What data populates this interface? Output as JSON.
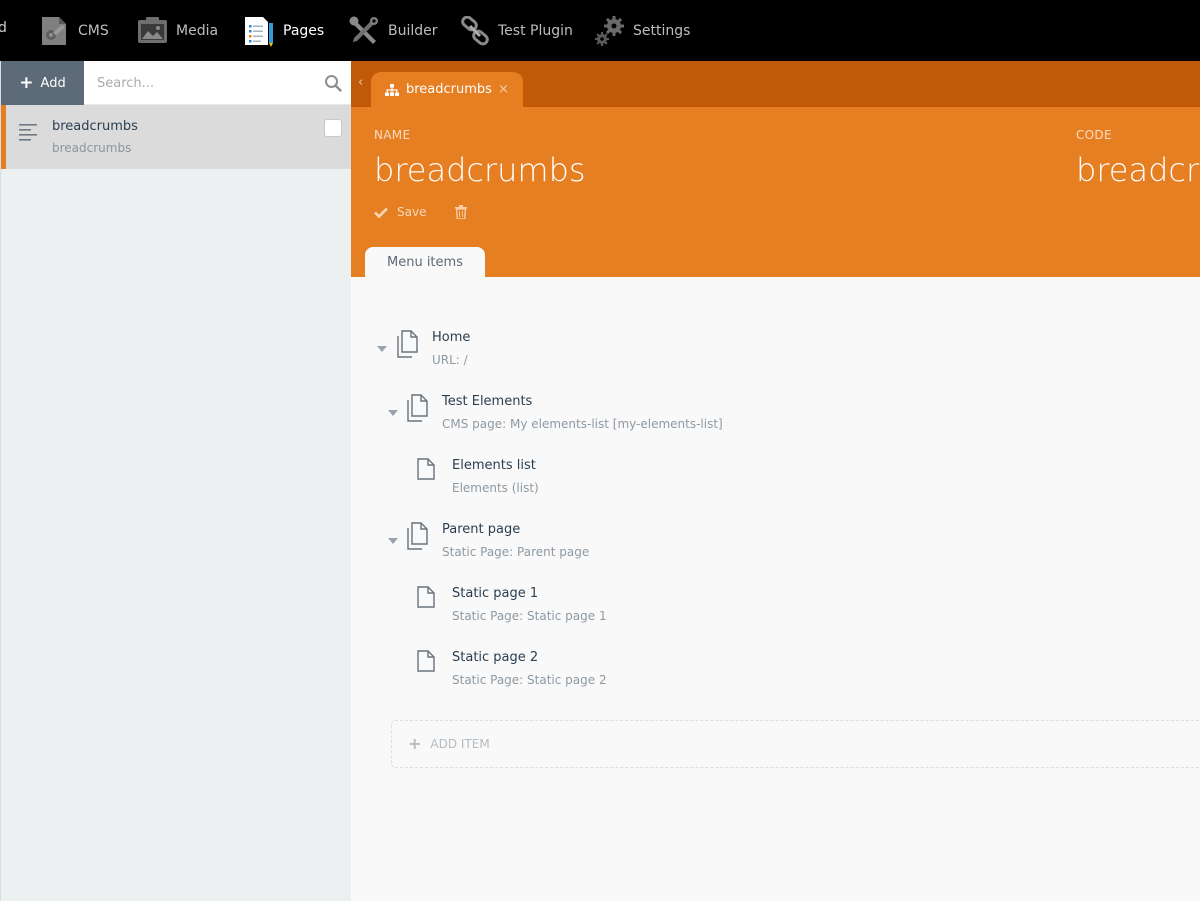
{
  "topnav": {
    "cut_label": "d",
    "items": [
      {
        "label": "CMS",
        "icon": "cms-icon"
      },
      {
        "label": "Media",
        "icon": "media-icon"
      },
      {
        "label": "Pages",
        "icon": "pages-icon",
        "active": true
      },
      {
        "label": "Builder",
        "icon": "builder-icon"
      },
      {
        "label": "Test Plugin",
        "icon": "link-icon"
      },
      {
        "label": "Settings",
        "icon": "gears-icon"
      }
    ]
  },
  "sidebar": {
    "add_label": "Add",
    "search_placeholder": "Search...",
    "items": [
      {
        "title": "breadcrumbs",
        "subtitle": "breadcrumbs"
      }
    ]
  },
  "main": {
    "tab": {
      "label": "breadcrumbs",
      "close": "×"
    },
    "tab_arrow": "‹",
    "name_label": "NAME",
    "name_value": "breadcrumbs",
    "code_label": "CODE",
    "code_value": "breadcrumbs",
    "save_label": "Save",
    "section_tab": "Menu items",
    "tree": [
      {
        "title": "Home",
        "subtitle": "URL: /",
        "level": 0,
        "expandable": true
      },
      {
        "title": "Test Elements",
        "subtitle": "CMS page: My elements-list [my-elements-list]",
        "level": 1,
        "expandable": true
      },
      {
        "title": "Elements list",
        "subtitle": "Elements (list)",
        "level": 2,
        "expandable": false
      },
      {
        "title": "Parent page",
        "subtitle": "Static Page: Parent page",
        "level": 1,
        "expandable": true
      },
      {
        "title": "Static page 1",
        "subtitle": "Static Page: Static page 1",
        "level": 2,
        "expandable": false
      },
      {
        "title": "Static page 2",
        "subtitle": "Static Page: Static page 2",
        "level": 2,
        "expandable": false
      }
    ],
    "add_item_label": "ADD ITEM"
  },
  "colors": {
    "accent": "#e67e22",
    "tabbar": "#c05a08",
    "topnav": "#000000",
    "sidebar": "#ecf0f1",
    "add_button": "#5d6a77"
  }
}
